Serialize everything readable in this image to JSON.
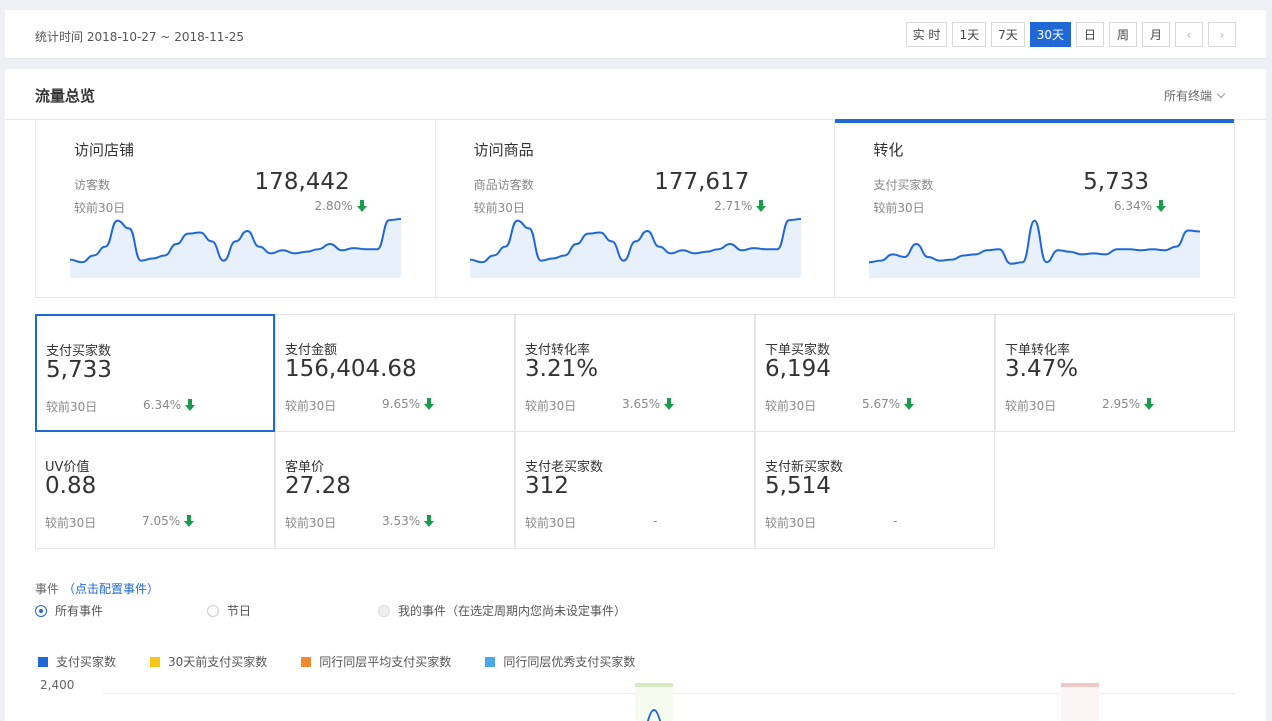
{
  "date_bar": {
    "stat_time": "统计时间 2018-10-27 ~ 2018-11-25",
    "ranges": [
      "实 时",
      "1天",
      "7天",
      "30天",
      "日",
      "周",
      "月"
    ],
    "active_range": "30天",
    "prev_icon": "chevron-left-icon",
    "next_icon": "chevron-right-icon"
  },
  "panel": {
    "title": "流量总览",
    "terminal_select": "所有终端"
  },
  "funnel": [
    {
      "title": "访问店铺",
      "label": "访客数",
      "value": "178,442",
      "compare": "较前30日",
      "pct": "2.80%",
      "trend": "down",
      "spark": [
        0.8,
        0.85,
        0.72,
        0.55,
        0.05,
        0.2,
        0.82,
        0.78,
        0.72,
        0.5,
        0.3,
        0.28,
        0.45,
        0.82,
        0.45,
        0.25,
        0.55,
        0.68,
        0.62,
        0.68,
        0.65,
        0.6,
        0.5,
        0.62,
        0.58,
        0.6,
        0.6,
        0.04,
        0.02
      ]
    },
    {
      "title": "访问商品",
      "label": "商品访客数",
      "value": "177,617",
      "compare": "较前30日",
      "pct": "2.71%",
      "trend": "down",
      "spark": [
        0.8,
        0.85,
        0.72,
        0.55,
        0.05,
        0.2,
        0.82,
        0.78,
        0.72,
        0.5,
        0.3,
        0.28,
        0.45,
        0.82,
        0.45,
        0.25,
        0.55,
        0.68,
        0.62,
        0.68,
        0.65,
        0.6,
        0.5,
        0.62,
        0.58,
        0.6,
        0.6,
        0.04,
        0.02
      ]
    },
    {
      "title": "转化",
      "label": "支付买家数",
      "value": "5,733",
      "compare": "较前30日",
      "pct": "6.34%",
      "trend": "down",
      "spark": [
        0.85,
        0.82,
        0.7,
        0.75,
        0.5,
        0.75,
        0.82,
        0.8,
        0.72,
        0.7,
        0.62,
        0.6,
        0.88,
        0.85,
        0.05,
        0.85,
        0.62,
        0.65,
        0.7,
        0.68,
        0.7,
        0.6,
        0.6,
        0.62,
        0.6,
        0.62,
        0.55,
        0.24,
        0.26
      ]
    }
  ],
  "active_funnel": 2,
  "metrics": [
    {
      "name": "支付买家数",
      "value": "5,733",
      "compare": "较前30日",
      "pct": "6.34%",
      "trend": "down"
    },
    {
      "name": "支付金额",
      "value": "156,404.68",
      "compare": "较前30日",
      "pct": "9.65%",
      "trend": "down"
    },
    {
      "name": "支付转化率",
      "value": "3.21%",
      "compare": "较前30日",
      "pct": "3.65%",
      "trend": "down"
    },
    {
      "name": "下单买家数",
      "value": "6,194",
      "compare": "较前30日",
      "pct": "5.67%",
      "trend": "down"
    },
    {
      "name": "下单转化率",
      "value": "3.47%",
      "compare": "较前30日",
      "pct": "2.95%",
      "trend": "down"
    },
    {
      "name": "UV价值",
      "value": "0.88",
      "compare": "较前30日",
      "pct": "7.05%",
      "trend": "down"
    },
    {
      "name": "客单价",
      "value": "27.28",
      "compare": "较前30日",
      "pct": "3.53%",
      "trend": "down"
    },
    {
      "name": "支付老买家数",
      "value": "312",
      "compare": "较前30日",
      "pct": "-",
      "trend": "none"
    },
    {
      "name": "支付新买家数",
      "value": "5,514",
      "compare": "较前30日",
      "pct": "-",
      "trend": "none"
    }
  ],
  "events": {
    "title": "事件",
    "config_link": "（点击配置事件）",
    "options": [
      {
        "label": "所有事件",
        "state": "on"
      },
      {
        "label": "节日",
        "state": "off"
      },
      {
        "label": "我的事件（在选定周期内您尚未设定事件）",
        "state": "disabled"
      }
    ]
  },
  "chart_data": {
    "type": "line",
    "series": [
      {
        "name": "支付买家数",
        "color": "#1f68d6"
      },
      {
        "name": "30天前支付买家数",
        "color": "#f5c518"
      },
      {
        "name": "同行同层平均支付买家数",
        "color": "#f08a30"
      },
      {
        "name": "同行同层优秀支付买家数",
        "color": "#4aa8e8"
      }
    ],
    "y_ticks": [
      "2,400"
    ]
  }
}
